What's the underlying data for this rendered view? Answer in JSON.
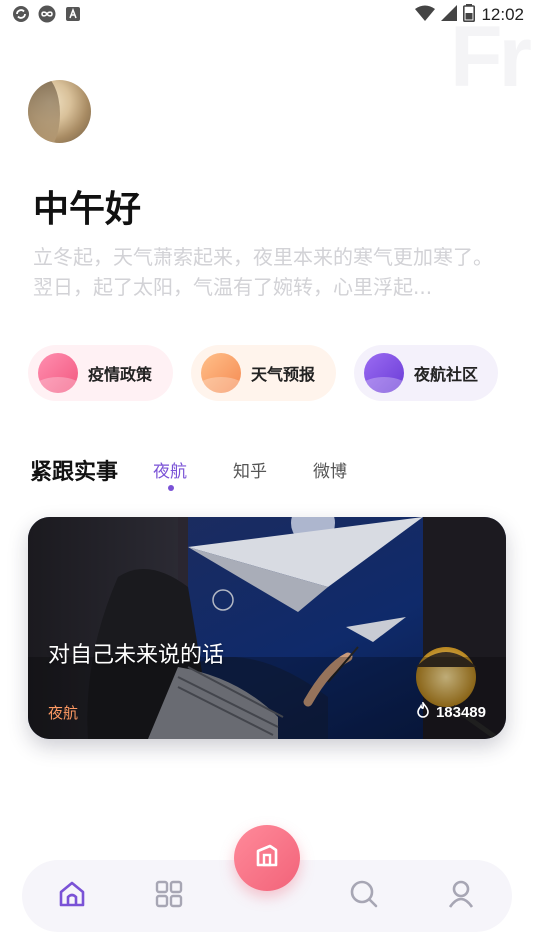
{
  "status_bar": {
    "time": "12:02",
    "left_icons": [
      "sync-icon",
      "infinity-icon",
      "font-icon"
    ],
    "right_icons": [
      "wifi-icon",
      "cellular-icon",
      "battery-icon"
    ]
  },
  "watermark": "Fr",
  "header": {
    "greeting": "中午好",
    "quote": "立冬起，天气萧索起来，夜里本来的寒气更加寒了。翌日，起了太阳，气温有了婉转，心里浮起..."
  },
  "quick_links": [
    {
      "label": "疫情政策",
      "color": "#f2577f"
    },
    {
      "label": "天气预报",
      "color": "#f58a52"
    },
    {
      "label": "夜航社区",
      "color": "#6a3bd6"
    }
  ],
  "feed": {
    "section_title": "紧跟实事",
    "tabs": [
      {
        "label": "夜航",
        "active": true
      },
      {
        "label": "知乎",
        "active": false
      },
      {
        "label": "微博",
        "active": false
      }
    ],
    "card": {
      "title": "对自己未来说的话",
      "tag": "夜航",
      "views": "183489"
    }
  },
  "bottom_nav": {
    "items": [
      "home-icon",
      "grid-icon",
      "search-icon",
      "user-icon"
    ],
    "center_action": "book-icon",
    "accent": "#7a52d6"
  }
}
